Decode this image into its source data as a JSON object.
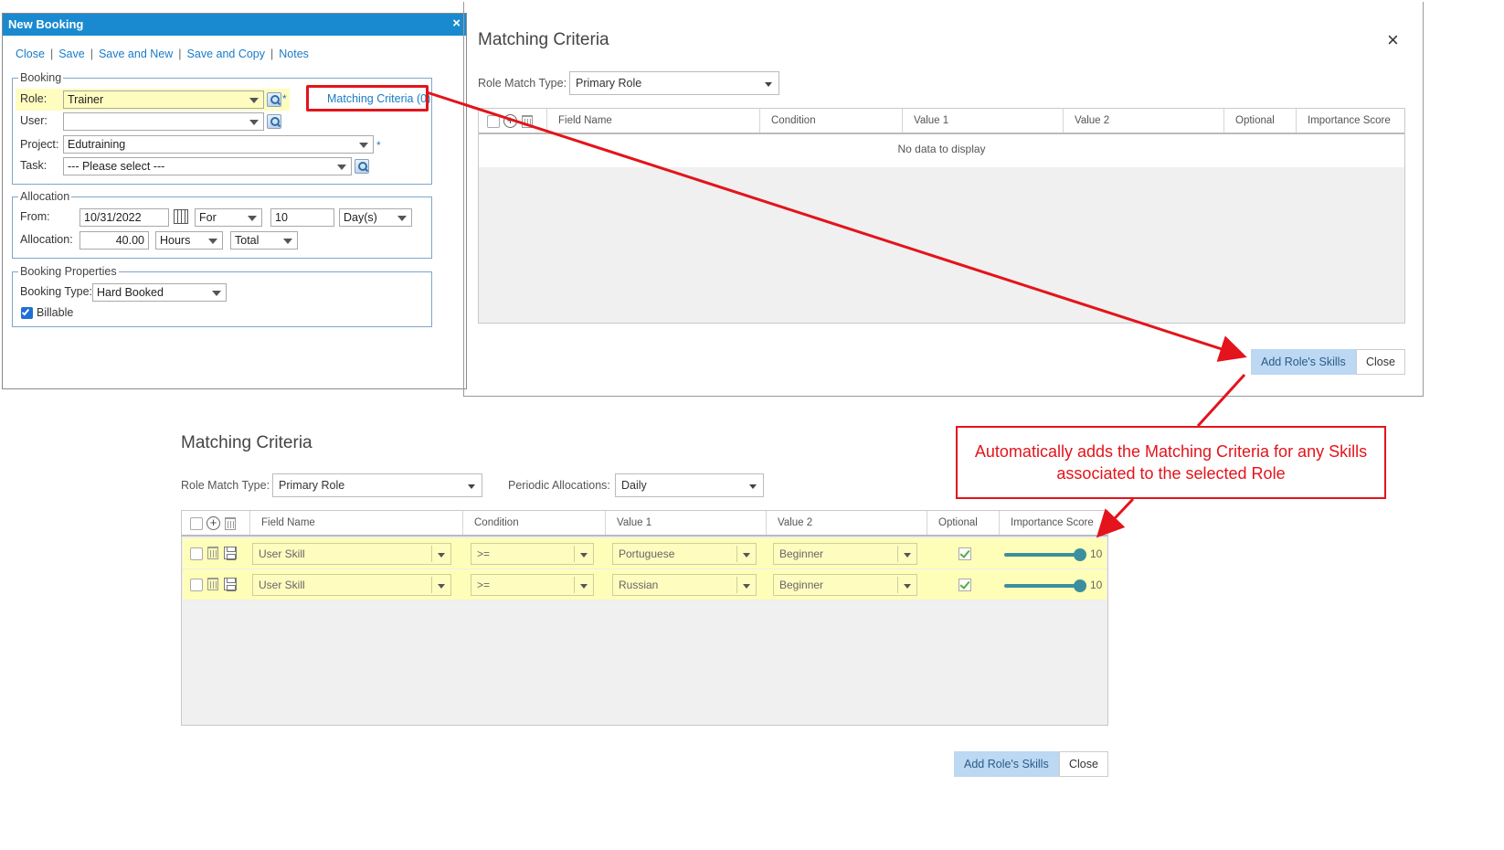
{
  "new_booking": {
    "title": "New Booking",
    "close_x": "×",
    "links": [
      "Close",
      "Save",
      "Save and New",
      "Save and Copy",
      "Notes"
    ],
    "booking_group": "Booking",
    "role_label": "Role:",
    "role_value": "Trainer",
    "matching_link": "Matching Criteria (0)",
    "user_label": "User:",
    "user_value": "",
    "project_label": "Project:",
    "project_value": "Edutraining",
    "task_label": "Task:",
    "task_value": "--- Please select ---",
    "required_mark": "*",
    "allocation_group": "Allocation",
    "from_label": "From:",
    "from_value": "10/31/2022",
    "for_value": "For",
    "duration_value": "10",
    "duration_unit": "Day(s)",
    "allocation_label": "Allocation:",
    "allocation_value": "40.00",
    "allocation_unit": "Hours",
    "allocation_mode": "Total",
    "props_group": "Booking Properties",
    "booking_type_label": "Booking Type:",
    "booking_type_value": "Hard Booked",
    "billable_label": "Billable",
    "billable_checked": true
  },
  "mc_top": {
    "title": "Matching Criteria",
    "close_x": "×",
    "role_match_label": "Role Match Type:",
    "role_match_value": "Primary Role",
    "columns": [
      "Field Name",
      "Condition",
      "Value 1",
      "Value 2",
      "Optional",
      "Importance Score"
    ],
    "empty_text": "No data to display",
    "add_btn": "Add Role's Skills",
    "close_btn": "Close"
  },
  "mc_bottom": {
    "title": "Matching Criteria",
    "role_match_label": "Role Match Type:",
    "role_match_value": "Primary Role",
    "periodic_label": "Periodic Allocations:",
    "periodic_value": "Daily",
    "columns": [
      "Field Name",
      "Condition",
      "Value 1",
      "Value 2",
      "Optional",
      "Importance Score"
    ],
    "rows": [
      {
        "field": "User Skill",
        "condition": ">=",
        "value1": "Portuguese",
        "value2": "Beginner",
        "optional": true,
        "score": "10"
      },
      {
        "field": "User Skill",
        "condition": ">=",
        "value1": "Russian",
        "value2": "Beginner",
        "optional": true,
        "score": "10"
      }
    ],
    "add_btn": "Add Role's Skills",
    "close_btn": "Close"
  },
  "callout": {
    "text": "Automatically adds the Matching Criteria for any Skills associated to the selected Role"
  },
  "colors": {
    "annotation_red": "#e3141b",
    "title_bar_blue": "#1a8ad0",
    "highlight_yellow": "#fffcc0",
    "primary_button": "#bcd8f2"
  }
}
